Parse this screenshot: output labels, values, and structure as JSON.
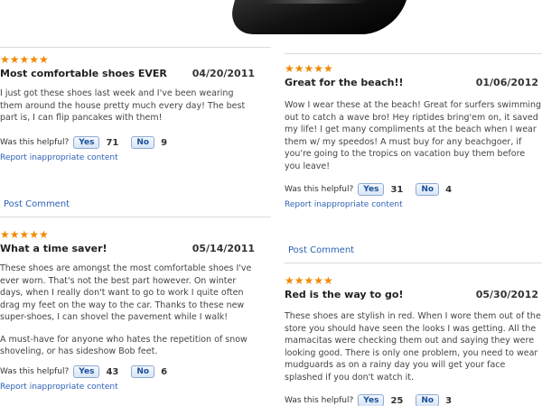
{
  "product": {
    "image_name": "black-shoe-image"
  },
  "labels": {
    "helpful": "Was this helpful?",
    "yes": "Yes",
    "no": "No",
    "report": "Report inappropriate content",
    "post_comment": "Post Comment"
  },
  "colors": {
    "stars": "#f08a00",
    "link": "#2d62b5",
    "button_text": "#1a4f9a"
  },
  "left_reviews": [
    {
      "stars": "★★★★★",
      "rating": 5,
      "title": "Most comfortable shoes EVER",
      "date": "04/20/2011",
      "paragraphs": [
        "I just got these shoes last week and I've been wearing them around the house pretty much every day! The best part is, I can flip pancakes with them!"
      ],
      "yes_count": "71",
      "no_count": "9"
    },
    {
      "stars": "★★★★★",
      "rating": 5,
      "title": "What a time saver!",
      "date": "05/14/2011",
      "paragraphs": [
        "These shoes are amongst the most comfortable shoes I've ever worn. That's not the best part however. On winter days, when I really don't want to go to work I quite often drag my feet on the way to the car. Thanks to these new super-shoes, I can shovel the pavement while I walk!",
        "A must-have for anyone who hates the repetition of snow shoveling, or has sideshow Bob feet."
      ],
      "yes_count": "43",
      "no_count": "6"
    }
  ],
  "right_reviews": [
    {
      "stars": "★★★★★",
      "rating": 5,
      "title": "Great for the beach!!",
      "date": "01/06/2012",
      "paragraphs": [
        "Wow I wear these at the beach! Great for surfers swimming out to catch a wave bro! Hey riptides bring'em on, it saved my life! I get many compliments at the beach when I wear them w/ my speedos! A must buy for any beachgoer, if you're going to the tropics on vacation buy them before you leave!"
      ],
      "yes_count": "31",
      "no_count": "4"
    },
    {
      "stars": "★★★★★",
      "rating": 5,
      "title": "Red is the way to go!",
      "date": "05/30/2012",
      "paragraphs": [
        "These shoes are stylish in red. When I wore them out of the store you should have seen the looks I was getting. All the mamacitas were checking them out and saying they were looking good. There is only one problem, you need to wear mudguards as on a rainy day you will get your face splashed if you don't watch it."
      ],
      "yes_count": "25",
      "no_count": "3"
    }
  ]
}
